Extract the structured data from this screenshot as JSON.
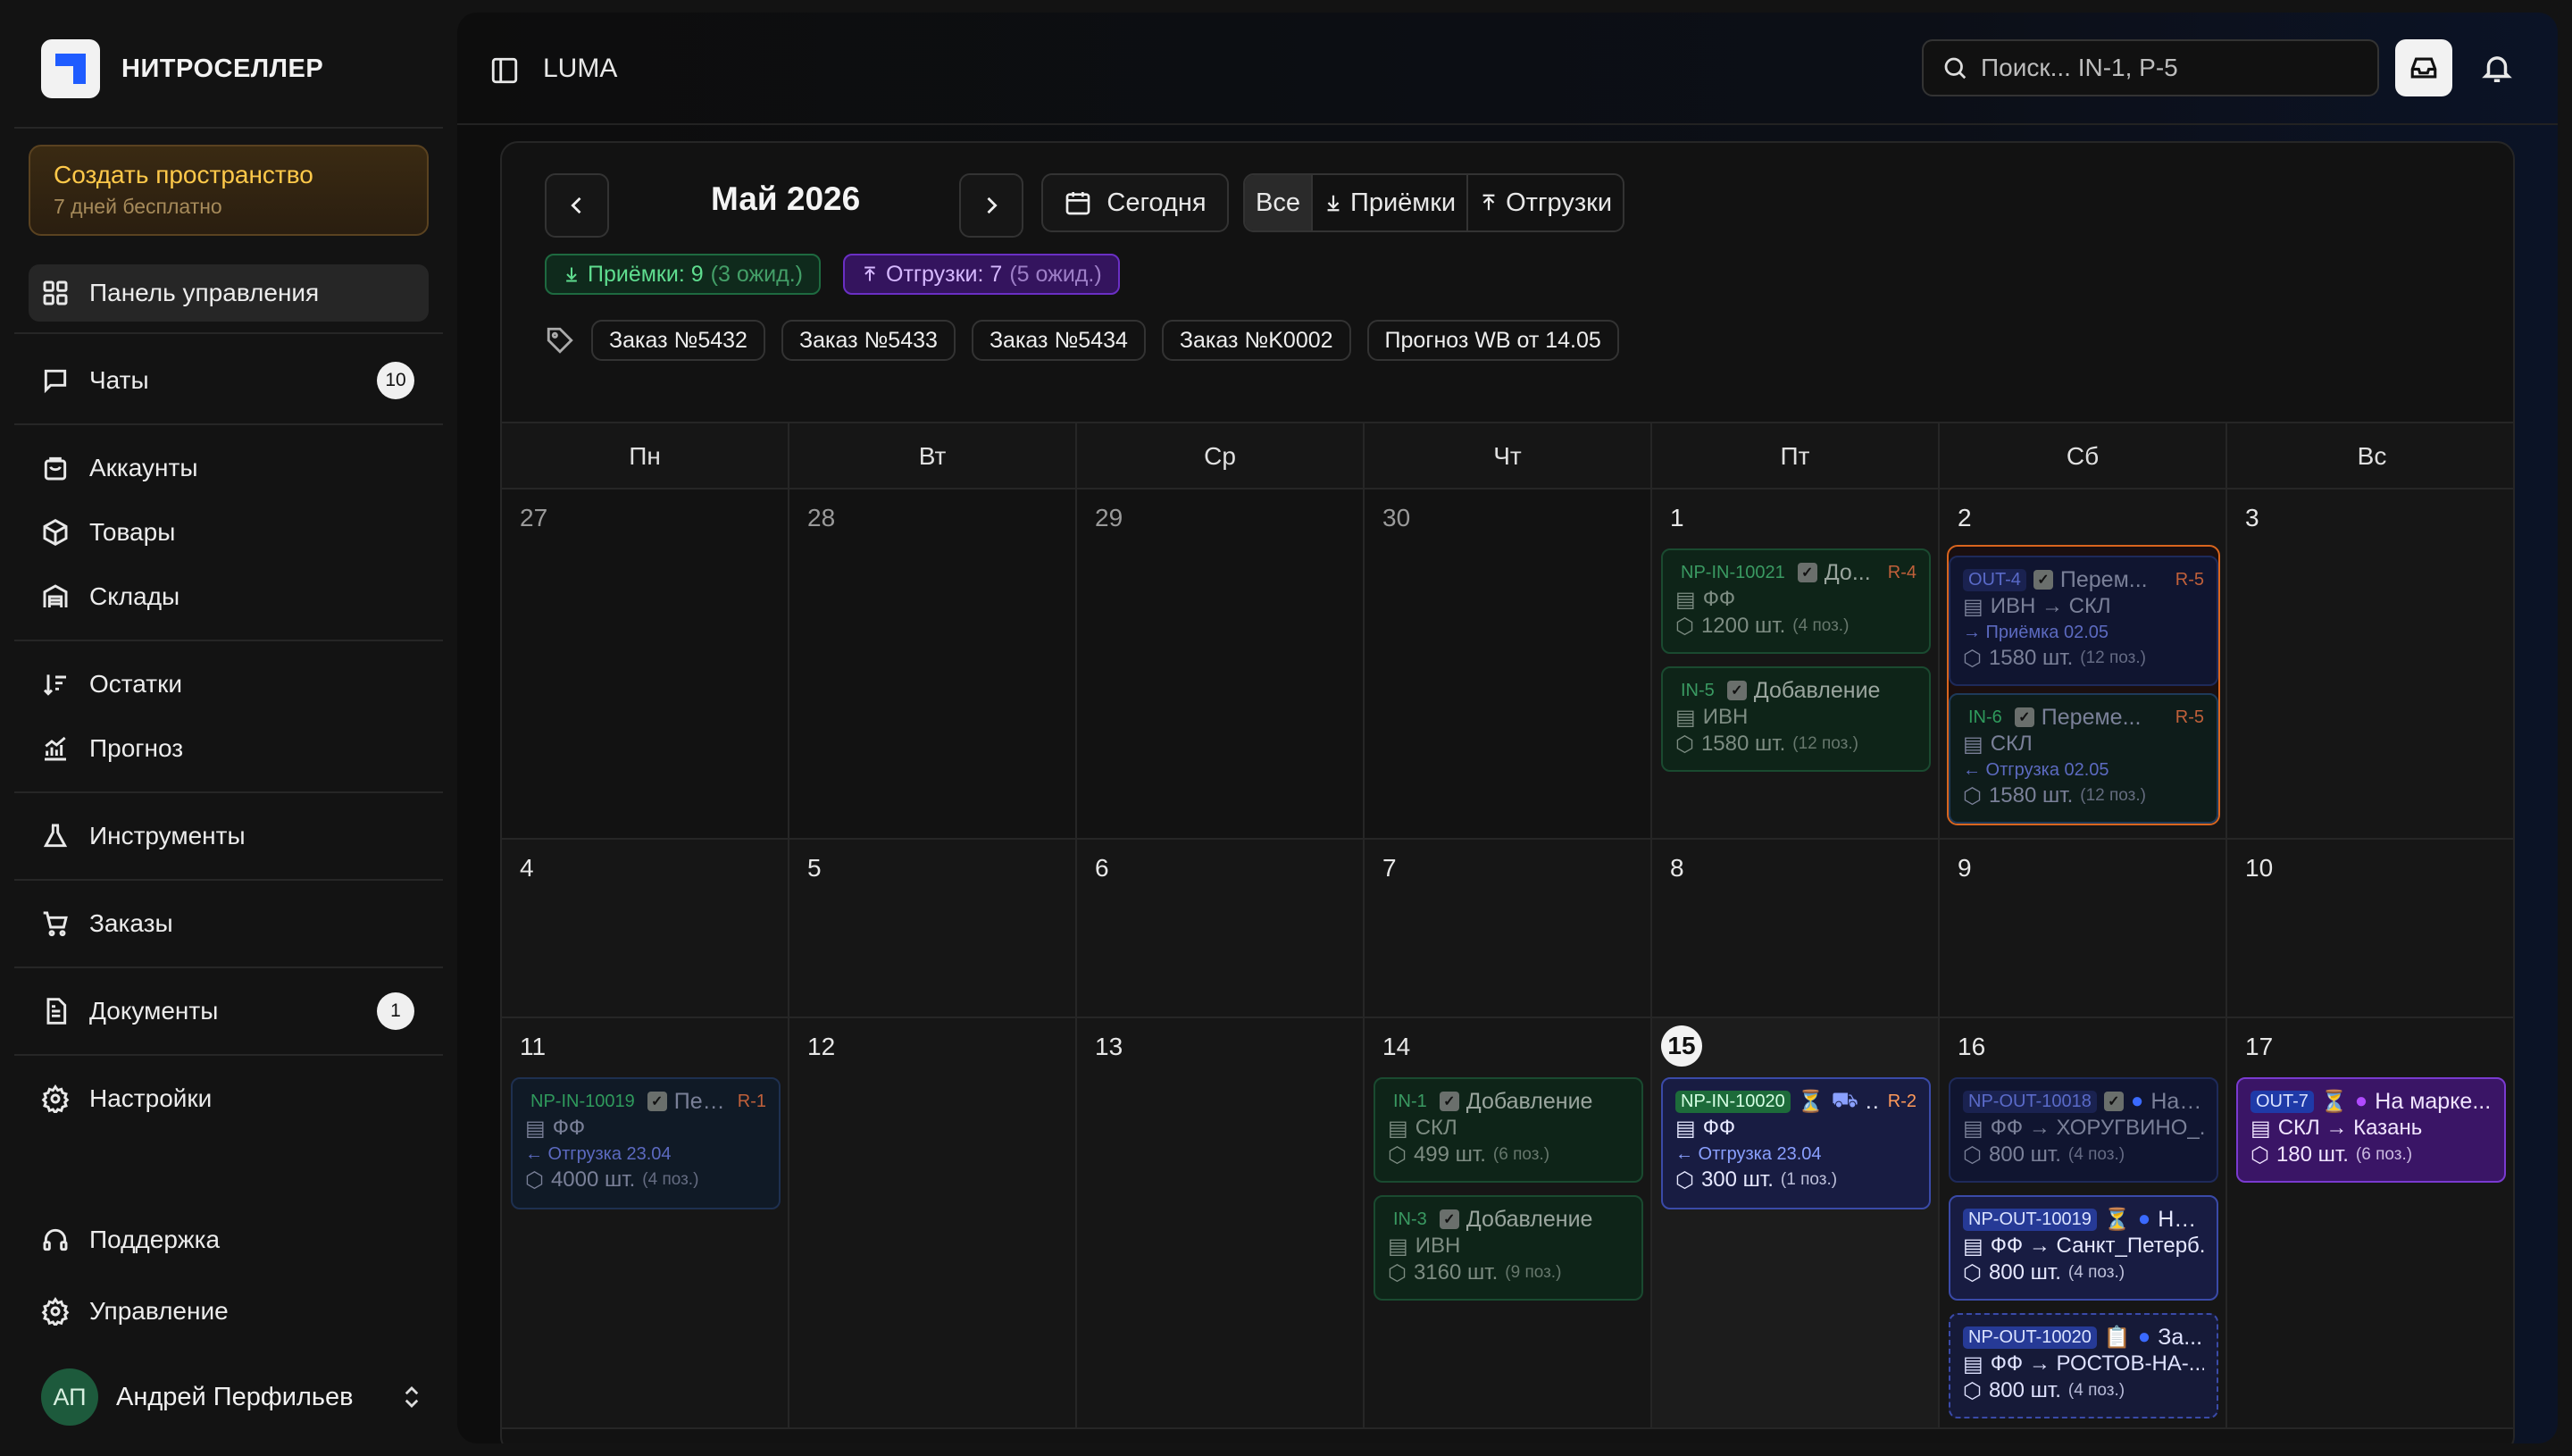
{
  "brand": {
    "name": "НИТРОСЕЛЛЕР"
  },
  "promo": {
    "title": "Создать пространство",
    "subtitle": "7 дней бесплатно"
  },
  "nav": {
    "dashboard": "Панель управления",
    "chats": "Чаты",
    "chats_badge": "10",
    "accounts": "Аккаунты",
    "products": "Товары",
    "warehouses": "Склады",
    "stock": "Остатки",
    "forecast": "Прогноз",
    "tools": "Инструменты",
    "orders": "Заказы",
    "documents": "Документы",
    "documents_badge": "1",
    "settings": "Настройки",
    "support": "Поддержка",
    "management": "Управление"
  },
  "user": {
    "initials": "АП",
    "name": "Андрей Перфильев"
  },
  "topbar": {
    "workspace": "LUMA",
    "search_placeholder": "Поиск... IN-1, P-5"
  },
  "calendar": {
    "month": "Май 2026",
    "today": "Сегодня",
    "filters": {
      "all": "Все",
      "inbound": "Приёмки",
      "outbound": "Отгрузки"
    },
    "stats": {
      "inbound": "Приёмки: 9",
      "inbound_wait": "(3 ожид.)",
      "outbound": "Отгрузки: 7",
      "outbound_wait": "(5 ожид.)"
    },
    "tags": [
      "Заказ №5432",
      "Заказ №5433",
      "Заказ №5434",
      "Заказ №K0002",
      "Прогноз WB от 14.05"
    ],
    "weekdays": [
      "Пн",
      "Вт",
      "Ср",
      "Чт",
      "Пт",
      "Сб",
      "Вс"
    ],
    "weeks": [
      [
        "27",
        "28",
        "29",
        "30",
        "1",
        "2",
        "3"
      ],
      [
        "4",
        "5",
        "6",
        "7",
        "8",
        "9",
        "10"
      ],
      [
        "11",
        "12",
        "13",
        "14",
        "15",
        "16",
        "17"
      ]
    ],
    "events": {
      "e1": {
        "code": "NP-IN-10021",
        "title": "До...",
        "ref": "R-4",
        "place": "ФФ",
        "qty": "1200 шт.",
        "pos": "(4 поз.)"
      },
      "e2": {
        "code": "IN-5",
        "title": "Добавление",
        "place": "ИВН",
        "qty": "1580 шт.",
        "pos": "(12 поз.)"
      },
      "e3": {
        "code": "OUT-4",
        "title": "Перем...",
        "ref": "R-5",
        "place": "ИВН → СКЛ",
        "note": "→ Приёмка 02.05",
        "qty": "1580 шт.",
        "pos": "(12 поз.)"
      },
      "e4": {
        "code": "IN-6",
        "title": "Переме...",
        "ref": "R-5",
        "place": "СКЛ",
        "note": "← Отгрузка 02.05",
        "qty": "1580 шт.",
        "pos": "(12 поз.)"
      },
      "e5": {
        "code": "NP-IN-10019",
        "title": "Пер...",
        "ref": "R-1",
        "place": "ФФ",
        "note": "← Отгрузка 23.04",
        "qty": "4000 шт.",
        "pos": "(4 поз.)"
      },
      "e6": {
        "code": "IN-1",
        "title": "Добавление",
        "place": "СКЛ",
        "qty": "499 шт.",
        "pos": "(6 поз.)"
      },
      "e7": {
        "code": "IN-3",
        "title": "Добавление",
        "place": "ИВН",
        "qty": "3160 шт.",
        "pos": "(9 поз.)"
      },
      "e8": {
        "code": "NP-IN-10020",
        "title": "...",
        "ref": "R-2",
        "place": "ФФ",
        "note": "← Отгрузка 23.04",
        "qty": "300 шт.",
        "pos": "(1 поз.)"
      },
      "e9": {
        "code": "NP-OUT-10018",
        "title": "На ...",
        "place": "ФФ → ХОРУГВИНО_...",
        "qty": "800 шт.",
        "pos": "(4 поз.)"
      },
      "e10": {
        "code": "NP-OUT-10019",
        "title": "На ...",
        "place": "ФФ → Санкт_Петерб...",
        "qty": "800 шт.",
        "pos": "(4 поз.)"
      },
      "e11": {
        "code": "NP-OUT-10020",
        "title": "За...",
        "place": "ФФ → РОСТОВ-НА-...",
        "qty": "800 шт.",
        "pos": "(4 поз.)"
      },
      "e12": {
        "code": "OUT-7",
        "title": "На марке...",
        "place": "СКЛ → Казань",
        "qty": "180 шт.",
        "pos": "(6 поз.)"
      }
    }
  },
  "colors": {
    "accent_blue": "#1f5cff",
    "inbound_green": "#5fdd8f",
    "outbound_purple": "#6a2fc4",
    "promo_yellow": "#ffc94a",
    "highlight_orange": "#d9651e"
  }
}
